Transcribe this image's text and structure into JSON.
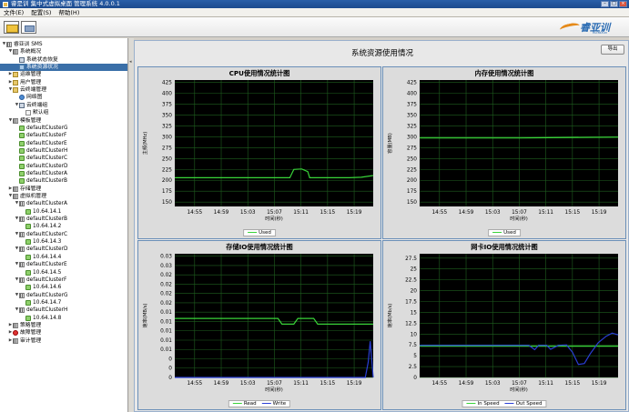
{
  "window": {
    "title": "睿是训  集中式虚拟桌面  管理系统  4.0.0.1"
  },
  "menu": [
    "文件(E)",
    "配置(S)",
    "帮助(H)"
  ],
  "logo": {
    "brand": "睿亚训",
    "sub": "RuiYaXun"
  },
  "sidebar": {
    "root": "睿亚训 SMS",
    "items": [
      {
        "label": "系统概况",
        "level": 1,
        "icon": "grid"
      },
      {
        "label": "系统状态恢复",
        "level": 2,
        "icon": "monitor"
      },
      {
        "label": "系统资源状况",
        "level": 2,
        "icon": "node",
        "selected": true
      },
      {
        "label": "运维管理",
        "level": 1,
        "icon": "folder"
      },
      {
        "label": "用户管理",
        "level": 1,
        "icon": "folder"
      },
      {
        "label": "云终端管理",
        "level": 1,
        "icon": "folder"
      },
      {
        "label": "网络图",
        "level": 2,
        "icon": "cloud"
      },
      {
        "label": "云终端组",
        "level": 2,
        "icon": "monitor"
      },
      {
        "label": "默认组",
        "level": 3,
        "icon": "doc"
      },
      {
        "label": "模板管理",
        "level": 1,
        "icon": "grid"
      },
      {
        "label": "defaultClusterG",
        "level": 2,
        "icon": "leaf"
      },
      {
        "label": "defaultClusterF",
        "level": 2,
        "icon": "leaf"
      },
      {
        "label": "defaultClusterE",
        "level": 2,
        "icon": "leaf"
      },
      {
        "label": "defaultClusterH",
        "level": 2,
        "icon": "leaf"
      },
      {
        "label": "defaultClusterC",
        "level": 2,
        "icon": "leaf"
      },
      {
        "label": "defaultClusterD",
        "level": 2,
        "icon": "leaf"
      },
      {
        "label": "defaultClusterA",
        "level": 2,
        "icon": "leaf"
      },
      {
        "label": "defaultClusterB",
        "level": 2,
        "icon": "leaf"
      },
      {
        "label": "存储管理",
        "level": 1,
        "icon": "grid"
      },
      {
        "label": "虚拟机管理",
        "level": 1,
        "icon": "grid"
      },
      {
        "label": "defaultClusterA",
        "level": 2,
        "icon": "grid"
      },
      {
        "label": "10.64.14.1",
        "level": 3,
        "icon": "leaf"
      },
      {
        "label": "defaultClusterB",
        "level": 2,
        "icon": "grid"
      },
      {
        "label": "10.64.14.2",
        "level": 3,
        "icon": "leaf"
      },
      {
        "label": "defaultClusterC",
        "level": 2,
        "icon": "grid"
      },
      {
        "label": "10.64.14.3",
        "level": 3,
        "icon": "leaf"
      },
      {
        "label": "defaultClusterD",
        "level": 2,
        "icon": "grid"
      },
      {
        "label": "10.64.14.4",
        "level": 3,
        "icon": "leaf"
      },
      {
        "label": "defaultClusterE",
        "level": 2,
        "icon": "grid"
      },
      {
        "label": "10.64.14.5",
        "level": 3,
        "icon": "leaf"
      },
      {
        "label": "defaultClusterF",
        "level": 2,
        "icon": "grid"
      },
      {
        "label": "10.64.14.6",
        "level": 3,
        "icon": "leaf"
      },
      {
        "label": "defaultClusterG",
        "level": 2,
        "icon": "grid"
      },
      {
        "label": "10.64.14.7",
        "level": 3,
        "icon": "leaf"
      },
      {
        "label": "defaultClusterH",
        "level": 2,
        "icon": "grid"
      },
      {
        "label": "10.64.14.8",
        "level": 3,
        "icon": "leaf"
      },
      {
        "label": "策略管理",
        "level": 1,
        "icon": "grid"
      },
      {
        "label": "故障管理",
        "level": 1,
        "icon": "red"
      },
      {
        "label": "审计管理",
        "level": 1,
        "icon": "grid"
      }
    ]
  },
  "main": {
    "title": "系统资源使用情况",
    "export_label": "导出"
  },
  "chart_data": [
    {
      "type": "line",
      "title": "CPU使用情况统计图",
      "xlabel": "时间(秒)",
      "ylabel": "主频(MHz)",
      "x_ticks": [
        "14:55",
        "14:59",
        "15:03",
        "15:07",
        "15:11",
        "15:15",
        "15:19"
      ],
      "y_ticks": [
        150,
        175,
        200,
        225,
        250,
        275,
        300,
        325,
        350,
        375,
        400,
        425
      ],
      "ylim": [
        140,
        430
      ],
      "line_color": "#39d339",
      "series": [
        {
          "name": "Used",
          "values": [
            {
              "t": 0.0,
              "v": 206
            },
            {
              "t": 0.58,
              "v": 206
            },
            {
              "t": 0.6,
              "v": 225
            },
            {
              "t": 0.64,
              "v": 226
            },
            {
              "t": 0.67,
              "v": 220
            },
            {
              "t": 0.68,
              "v": 206
            },
            {
              "t": 0.88,
              "v": 206
            },
            {
              "t": 0.94,
              "v": 207
            },
            {
              "t": 1.0,
              "v": 211
            }
          ]
        }
      ]
    },
    {
      "type": "line",
      "title": "内存使用情况统计图",
      "xlabel": "时间(秒)",
      "ylabel": "容量(MB)",
      "x_ticks": [
        "14:55",
        "14:59",
        "15:03",
        "15:07",
        "15:11",
        "15:15",
        "15:19"
      ],
      "y_ticks": [
        150,
        175,
        200,
        225,
        250,
        275,
        300,
        325,
        350,
        375,
        400,
        425
      ],
      "ylim": [
        140,
        430
      ],
      "line_color": "#39d339",
      "series": [
        {
          "name": "Used",
          "values": [
            {
              "t": 0.0,
              "v": 297
            },
            {
              "t": 0.5,
              "v": 297
            },
            {
              "t": 1.0,
              "v": 299
            }
          ]
        }
      ]
    },
    {
      "type": "line",
      "title": "存储IO使用情况统计图",
      "xlabel": "时间(秒)",
      "ylabel": "速率(MB/s)",
      "x_ticks": [
        "14:55",
        "14:59",
        "15:03",
        "15:07",
        "15:11",
        "15:15",
        "15:19"
      ],
      "y_ticks": [
        "0",
        "0",
        "0",
        "0.01",
        "0.01",
        "0.01",
        "0.01",
        "0.01",
        "0.02",
        "0.02",
        "0.02",
        "0.02",
        "0.03",
        "0.03"
      ],
      "ylim": [
        0,
        13
      ],
      "line_color": "#39d339",
      "series": [
        {
          "name": "Read",
          "color": "#39d339",
          "values": [
            {
              "t": 0.0,
              "v": 6.2
            },
            {
              "t": 0.52,
              "v": 6.2
            },
            {
              "t": 0.54,
              "v": 5.6
            },
            {
              "t": 0.6,
              "v": 5.6
            },
            {
              "t": 0.62,
              "v": 6.2
            },
            {
              "t": 0.7,
              "v": 6.2
            },
            {
              "t": 0.72,
              "v": 5.6
            },
            {
              "t": 1.0,
              "v": 5.6
            }
          ]
        },
        {
          "name": "Write",
          "color": "#2a3fd6",
          "values": [
            {
              "t": 0.0,
              "v": 0
            },
            {
              "t": 0.96,
              "v": 0
            },
            {
              "t": 0.975,
              "v": 1.6
            },
            {
              "t": 0.985,
              "v": 3.8
            },
            {
              "t": 1.0,
              "v": 0
            }
          ]
        }
      ]
    },
    {
      "type": "line",
      "title": "网卡IO使用情况统计图",
      "xlabel": "时间(秒)",
      "ylabel": "速率(Mb/s)",
      "x_ticks": [
        "14:55",
        "14:59",
        "15:03",
        "15:07",
        "15:11",
        "15:15",
        "15:19"
      ],
      "y_ticks": [
        0,
        2.5,
        5,
        7.5,
        10,
        12.5,
        15,
        17.5,
        20,
        22.5,
        25,
        27.5
      ],
      "ylim": [
        0,
        28.5
      ],
      "line_color": "#39d339",
      "series": [
        {
          "name": "In Speed",
          "color": "#39d339",
          "values": [
            {
              "t": 0.0,
              "v": 7.2
            },
            {
              "t": 1.0,
              "v": 7.2
            }
          ]
        },
        {
          "name": "Out Speed",
          "color": "#2a3fd6",
          "values": [
            {
              "t": 0.0,
              "v": 7.4
            },
            {
              "t": 0.55,
              "v": 7.4
            },
            {
              "t": 0.58,
              "v": 6.4
            },
            {
              "t": 0.6,
              "v": 7.4
            },
            {
              "t": 0.64,
              "v": 7.4
            },
            {
              "t": 0.66,
              "v": 6.5
            },
            {
              "t": 0.7,
              "v": 7.4
            },
            {
              "t": 0.74,
              "v": 7.5
            },
            {
              "t": 0.77,
              "v": 5.8
            },
            {
              "t": 0.8,
              "v": 3.0
            },
            {
              "t": 0.83,
              "v": 3.2
            },
            {
              "t": 0.86,
              "v": 5.5
            },
            {
              "t": 0.9,
              "v": 8.0
            },
            {
              "t": 0.94,
              "v": 9.5
            },
            {
              "t": 0.97,
              "v": 10.2
            },
            {
              "t": 1.0,
              "v": 9.8
            }
          ]
        }
      ]
    }
  ]
}
